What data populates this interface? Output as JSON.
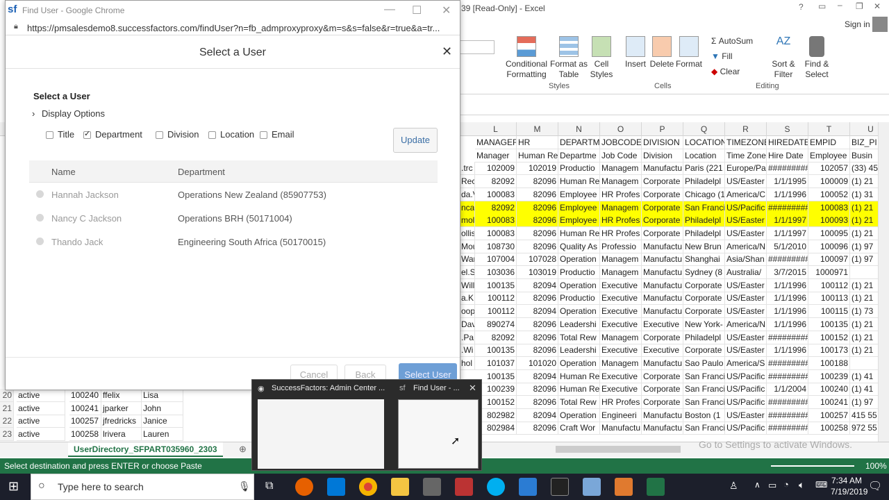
{
  "excel": {
    "title": "39  [Read-Only]  -  Excel",
    "signin": "Sign in",
    "ribbon": {
      "conditional": "Conditional Formatting",
      "format_table": "Format as Table",
      "cell_styles": "Cell Styles",
      "styles_group": "Styles",
      "insert": "Insert",
      "delete": "Delete",
      "format": "Format",
      "cells_group": "Cells",
      "autosum": "AutoSum",
      "fill": "Fill",
      "clear": "Clear",
      "sort_filter": "Sort & Filter",
      "find_select": "Find & Select",
      "editing_group": "Editing"
    },
    "columns": [
      "L",
      "M",
      "N",
      "O",
      "P",
      "Q",
      "R",
      "S",
      "T",
      "U"
    ],
    "headers_row": [
      "MANAGEF",
      "HR",
      "DEPARTM",
      "JOBCODE",
      "DIVISION",
      "LOCATION",
      "TIMEZONE",
      "HIREDATE",
      "EMPID",
      "BIZ_PI"
    ],
    "subheaders_row": [
      "Manager",
      "Human Re",
      "Departme",
      "Job Code",
      "Division",
      "Location",
      "Time Zone",
      "Hire Date",
      "Employee",
      "Busin"
    ],
    "left_cells": [
      ".trc",
      "Reck",
      "da.V",
      "nca",
      "mol",
      "ollis",
      "Mou",
      "Wan",
      "el.S",
      "Willi",
      "a.K",
      "oop",
      "Dav",
      ".Pa",
      ".Wi",
      "hol"
    ],
    "rows": [
      [
        "102009",
        "102019",
        "Productio",
        "Managem",
        "Manufactu",
        "Paris (221",
        "Europe/Pa",
        "#########",
        "102057",
        "(33) 45"
      ],
      [
        "82092",
        "82096",
        "Human Re",
        "Managem",
        "Corporate",
        "Philadelpl",
        "US/Easter",
        "1/1/1995",
        "100009",
        "(1) 21"
      ],
      [
        "100083",
        "82096",
        "Employee",
        "HR Profes",
        "Corporate",
        "Chicago (1",
        "America/C",
        "1/1/1996",
        "100052",
        "(1) 31"
      ],
      [
        "82092",
        "82096",
        "Employee",
        "Managem",
        "Corporate",
        "San Franci",
        "US/Pacific",
        "#########",
        "100083",
        "(1) 21"
      ],
      [
        "100083",
        "82096",
        "Employee",
        "HR Profes",
        "Corporate",
        "Philadelpl",
        "US/Easter",
        "1/1/1997",
        "100093",
        "(1) 21"
      ],
      [
        "100083",
        "82096",
        "Human Re",
        "HR Profes",
        "Corporate",
        "Philadelpl",
        "US/Easter",
        "1/1/1997",
        "100095",
        "(1) 21"
      ],
      [
        "108730",
        "82096",
        "Quality As",
        "Professio",
        "Manufactu",
        "New Brun",
        "America/N",
        "5/1/2010",
        "100096",
        "(1) 97"
      ],
      [
        "107004",
        "107028",
        "Operation",
        "Managem",
        "Manufactu",
        "Shanghai",
        "Asia/Shan",
        "#########",
        "100097",
        "(1) 97"
      ],
      [
        "103036",
        "103019",
        "Productio",
        "Managem",
        "Manufactu",
        "Sydney (8",
        "Australia/",
        "3/7/2015",
        "1000971",
        ""
      ],
      [
        "100135",
        "82094",
        "Operation",
        "Executive",
        "Manufactu",
        "Corporate",
        "US/Easter",
        "1/1/1996",
        "100112",
        "(1) 21"
      ],
      [
        "100112",
        "82096",
        "Productio",
        "Executive",
        "Manufactu",
        "Corporate",
        "US/Easter",
        "1/1/1996",
        "100113",
        "(1) 21"
      ],
      [
        "100112",
        "82094",
        "Operation",
        "Executive",
        "Manufactu",
        "Corporate",
        "US/Easter",
        "1/1/1996",
        "100115",
        "(1) 73"
      ],
      [
        "890274",
        "82096",
        "Leadershi",
        "Executive",
        "Executive",
        "New York-",
        "America/N",
        "1/1/1996",
        "100135",
        "(1) 21"
      ],
      [
        "82092",
        "82096",
        "Total Rew",
        "Managem",
        "Corporate",
        "Philadelpl",
        "US/Easter",
        "#########",
        "100152",
        "(1) 21"
      ],
      [
        "100135",
        "82096",
        "Leadershi",
        "Executive",
        "Executive",
        "Corporate",
        "US/Easter",
        "1/1/1996",
        "100173",
        "(1) 21"
      ],
      [
        "101037",
        "101020",
        "Operation",
        "Managem",
        "Manufactu",
        "Sao Paulo",
        "America/S",
        "#########",
        "100188",
        ""
      ],
      [
        "100135",
        "82094",
        "Human Re",
        "Executive",
        "Corporate",
        "San Franci",
        "US/Pacific",
        "#########",
        "100239",
        "(1) 41"
      ],
      [
        "100239",
        "82096",
        "Human Re",
        "Executive",
        "Corporate",
        "San Franci",
        "US/Pacific",
        "1/1/2004",
        "100240",
        "(1) 41"
      ],
      [
        "100152",
        "82096",
        "Total Rew",
        "HR Profes",
        "Corporate",
        "San Franci",
        "US/Pacific",
        "#########",
        "100241",
        "(1) 97"
      ],
      [
        "802982",
        "82094",
        "Operation",
        "Engineeri",
        "Manufactu",
        "Boston (1",
        "US/Easter",
        "#########",
        "100257",
        "415 55"
      ],
      [
        "802984",
        "82096",
        "Craft Wor",
        "Manufactu",
        "Manufactu",
        "San Franci",
        "US/Pacific",
        "#########",
        "100258",
        "972 55"
      ]
    ],
    "bottom_rows": [
      {
        "num": "20",
        "status": "active",
        "id": "100240",
        "user": "ffelix",
        "name": "Lisa"
      },
      {
        "num": "21",
        "status": "active",
        "id": "100241",
        "user": "jparker",
        "name": "John"
      },
      {
        "num": "22",
        "status": "active",
        "id": "100257",
        "user": "jfredricks",
        "name": "Janice"
      },
      {
        "num": "23",
        "status": "active",
        "id": "100258",
        "user": "lrivera",
        "name": "Lauren"
      }
    ],
    "sheet_tab": "UserDirectory_SFPART035960_2303",
    "status_text": "Select destination and press ENTER or choose Paste",
    "zoom": "100%",
    "activate_windows": "Go to Settings to activate Windows."
  },
  "chrome": {
    "title": "Find User - Google Chrome",
    "url": "https://pmsalesdemo8.successfactors.com/findUser?n=fb_admproxyproxy&m=s&s=false&r=true&a=tr..."
  },
  "dialog": {
    "title": "Select a User",
    "section": "Select a User",
    "display_options": "Display Options",
    "checks": [
      {
        "label": "Title",
        "checked": false
      },
      {
        "label": "Department",
        "checked": true
      },
      {
        "label": "Division",
        "checked": false
      },
      {
        "label": "Location",
        "checked": false
      },
      {
        "label": "Email",
        "checked": false
      }
    ],
    "update": "Update",
    "col_name": "Name",
    "col_department": "Department",
    "users": [
      {
        "name": "Hannah Jackson",
        "dept": "Operations New Zealand (85907753)"
      },
      {
        "name": "Nancy C Jackson",
        "dept": "Operations BRH (50171004)"
      },
      {
        "name": "Thando Jack",
        "dept": "Engineering South Africa (50170015)"
      }
    ],
    "cancel": "Cancel",
    "back": "Back",
    "select_user": "Select User"
  },
  "taskthumbs": {
    "t1": "SuccessFactors: Admin Center ...",
    "t2": "Find User - ..."
  },
  "taskbar": {
    "search": "Type here to search",
    "time": "7:34 AM",
    "date": "7/19/2019"
  }
}
